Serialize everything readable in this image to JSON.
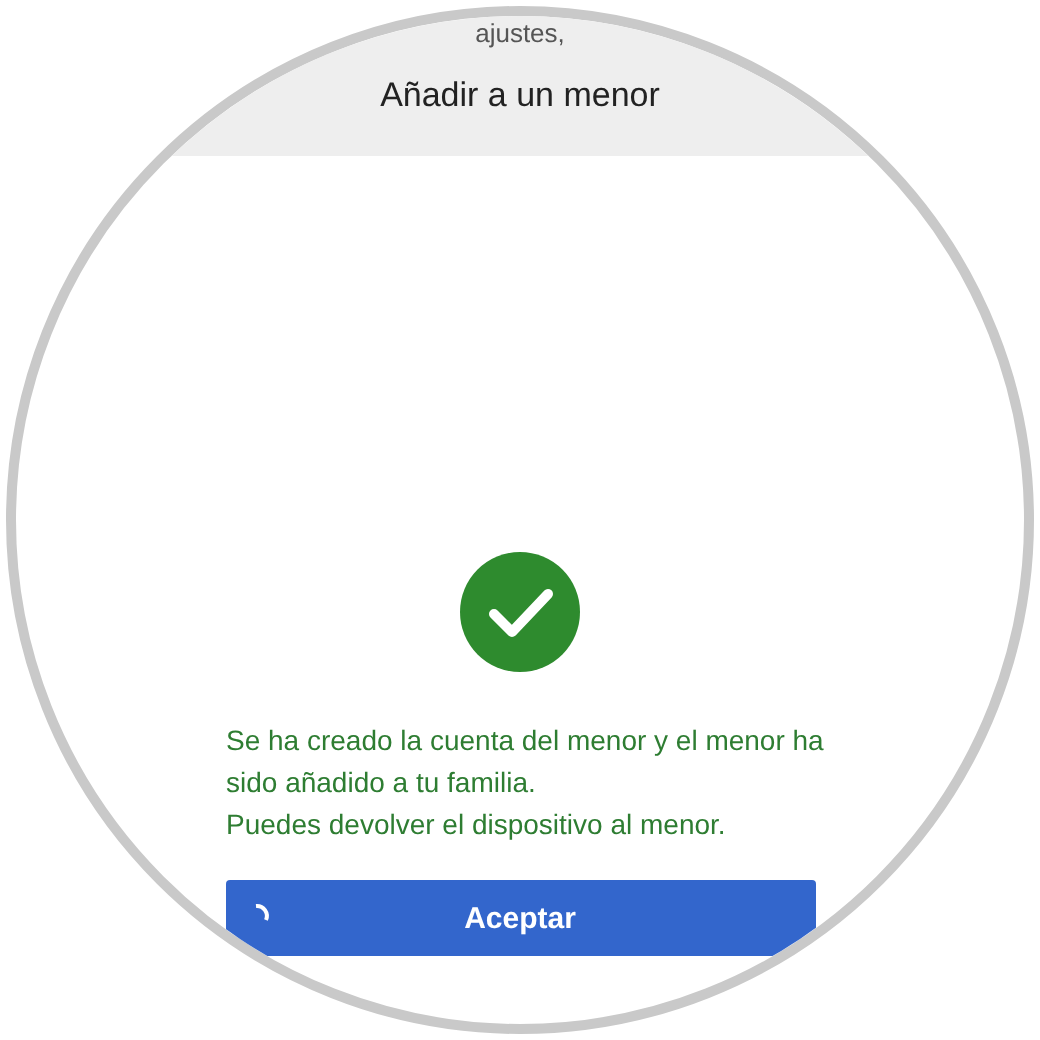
{
  "header": {
    "previous_text": "ajustes,",
    "title": "Añadir a un menor"
  },
  "message": {
    "lines": [
      "Se ha creado la cuenta del menor y el menor ha",
      "sido añadido a tu familia.",
      "Puedes devolver el dispositivo al menor."
    ]
  },
  "button": {
    "label": "Aceptar"
  }
}
